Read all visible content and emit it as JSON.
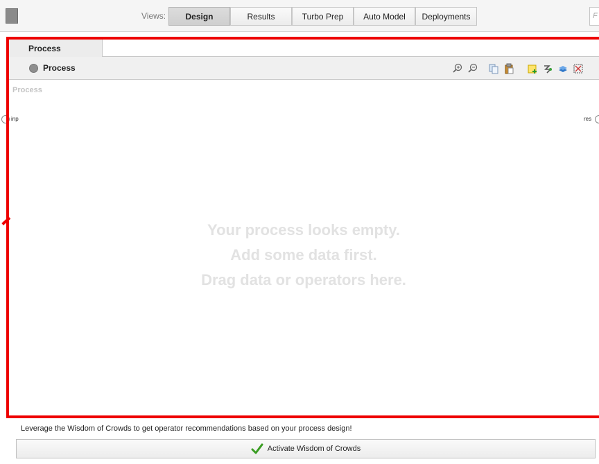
{
  "toolbar": {
    "views_label": "Views:",
    "tabs": [
      {
        "label": "Design",
        "active": true
      },
      {
        "label": "Results",
        "active": false
      },
      {
        "label": "Turbo Prep",
        "active": false
      },
      {
        "label": "Auto Model",
        "active": false
      },
      {
        "label": "Deployments",
        "active": false
      }
    ],
    "search_placeholder": "F"
  },
  "process_panel": {
    "tab_label": "Process",
    "breadcrumb_label": "Process",
    "tools": [
      "zoom-in-icon",
      "zoom-out-icon",
      "copy-icon",
      "paste-icon",
      "add-note-icon",
      "auto-wire-icon",
      "layer-icon",
      "fit-view-icon"
    ],
    "canvas": {
      "title": "Process",
      "input_port": "inp",
      "output_port": "res",
      "empty_lines": [
        "Your process looks empty.",
        "Add some data first.",
        "Drag data or operators here."
      ]
    }
  },
  "wisdom_of_crowds": {
    "hint": "Leverage the Wisdom of Crowds to get operator recommendations based on your process design!",
    "button_label": "Activate Wisdom of Crowds"
  },
  "colors": {
    "highlight": "#ee0000",
    "active_tab": "#d4d4d4",
    "empty_text": "#e2e2e2"
  }
}
